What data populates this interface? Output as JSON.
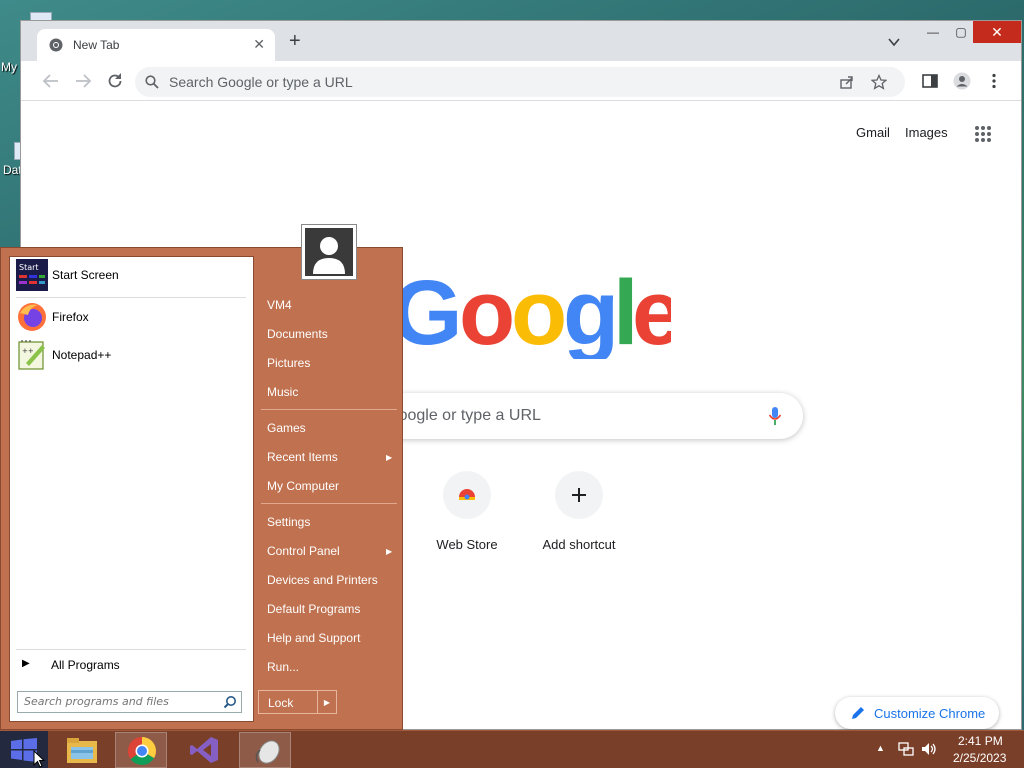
{
  "desktop": {
    "icon1_label": "My",
    "icon2_label": "Dat"
  },
  "chrome": {
    "tab_title": "New Tab",
    "omnibox_placeholder": "Search Google or type a URL",
    "top_links": {
      "gmail": "Gmail",
      "images": "Images"
    },
    "search_placeholder": "Search Google or type a URL",
    "shortcuts": [
      {
        "label": "Web Store"
      },
      {
        "label": "Add shortcut"
      }
    ],
    "customize_label": "Customize Chrome",
    "colors": {
      "accent": "#1a73e8",
      "close": "#c42b1c"
    }
  },
  "start_menu": {
    "pinned": [
      {
        "label": "Start Screen",
        "icon": "start-screen-icon",
        "icon_text": "Start"
      },
      {
        "label": "Firefox",
        "icon": "firefox-icon"
      },
      {
        "label": "Notepad++",
        "icon": "notepadpp-icon"
      }
    ],
    "all_programs": "All Programs",
    "search_placeholder": "Search programs and files",
    "right_links": [
      {
        "label": "VM4"
      },
      {
        "label": "Documents"
      },
      {
        "label": "Pictures"
      },
      {
        "label": "Music"
      },
      {
        "label": "Games"
      },
      {
        "label": "Recent Items"
      },
      {
        "label": "My Computer"
      },
      {
        "label": "Settings"
      },
      {
        "label": "Control Panel"
      },
      {
        "label": "Devices and Printers"
      },
      {
        "label": "Default Programs"
      },
      {
        "label": "Help and Support"
      },
      {
        "label": "Run..."
      }
    ],
    "lock_label": "Lock",
    "colors": {
      "menu_bg": "#c0714f"
    }
  },
  "taskbar": {
    "apps": [
      "file-explorer-icon",
      "chrome-icon",
      "visual-studio-icon",
      "mouse-app-icon"
    ],
    "time": "2:41 PM",
    "date": "2/25/2023"
  }
}
